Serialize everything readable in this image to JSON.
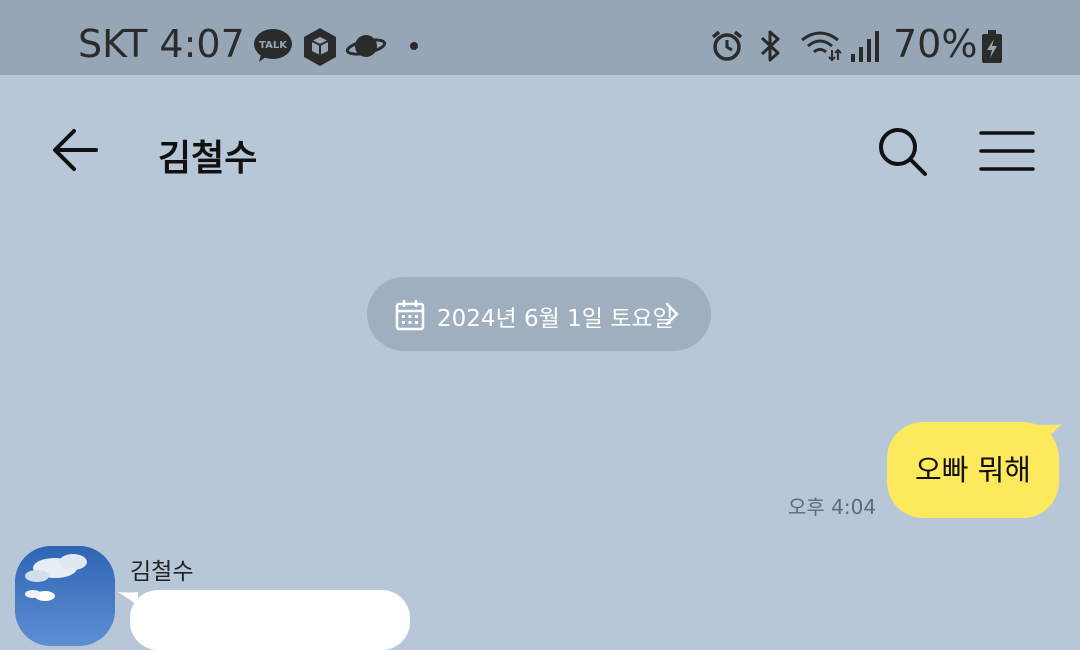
{
  "status_bar": {
    "carrier": "SKT",
    "time": "4:07",
    "battery": "70%",
    "icons": [
      "talk-icon",
      "box-icon",
      "planet-icon",
      "dot-icon",
      "alarm-icon",
      "bluetooth-icon",
      "wifi-icon",
      "signal-icon",
      "battery-icon"
    ]
  },
  "header": {
    "title": "김철수",
    "icons": [
      "back-arrow-icon",
      "search-icon",
      "menu-icon"
    ]
  },
  "date_divider": {
    "text": "2024년 6월 1일 토요일",
    "icons": [
      "calendar-icon",
      "chevron-right-icon"
    ]
  },
  "messages": [
    {
      "from": "me",
      "text": "오빠 뭐해",
      "time": "오후 4:04",
      "bubble_color": "#fde95c"
    },
    {
      "from": "other",
      "sender": "김철수",
      "text": ""
    }
  ],
  "colors": {
    "chat_background": "#b7c7d7",
    "status_bar": "#97a6b6",
    "date_pill": "#a0afbf",
    "my_bubble": "#fde95c",
    "their_bubble": "#ffffff"
  }
}
